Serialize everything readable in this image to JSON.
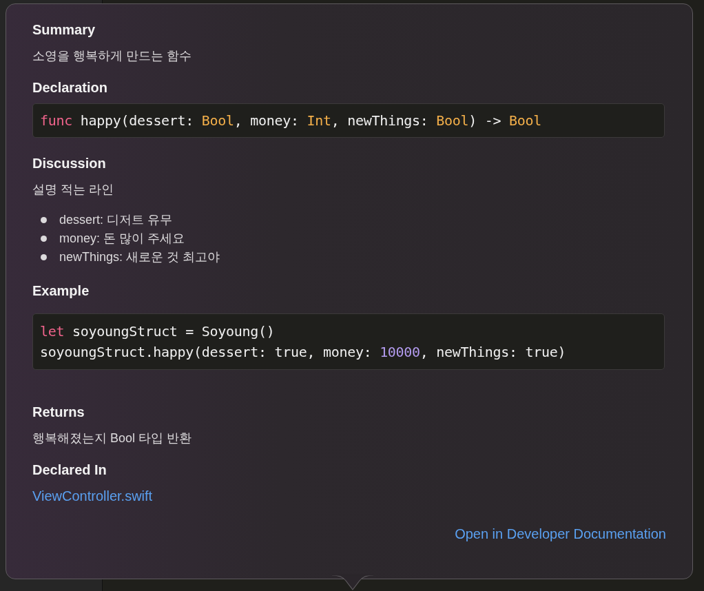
{
  "summary": {
    "heading": "Summary",
    "text": "소영을 행복하게 만드는 함수"
  },
  "declaration": {
    "heading": "Declaration",
    "lines": [
      [
        {
          "kind": "keyword",
          "text": "func"
        },
        {
          "kind": "plain",
          "text": " happy(dessert: "
        },
        {
          "kind": "type",
          "text": "Bool"
        },
        {
          "kind": "plain",
          "text": ", money: "
        },
        {
          "kind": "type",
          "text": "Int"
        },
        {
          "kind": "plain",
          "text": ", newThings: "
        },
        {
          "kind": "type",
          "text": "Bool"
        },
        {
          "kind": "plain",
          "text": ") -> "
        },
        {
          "kind": "type",
          "text": "Bool"
        }
      ]
    ]
  },
  "discussion": {
    "heading": "Discussion",
    "text": "설명 적는 라인",
    "bullets": [
      "dessert: 디저트 유무",
      "money: 돈 많이 주세요",
      "newThings: 새로운 것 최고야"
    ]
  },
  "example": {
    "heading": "Example",
    "lines": [
      [
        {
          "kind": "keyword",
          "text": "let"
        },
        {
          "kind": "plain",
          "text": " soyoungStruct = Soyoung()"
        }
      ],
      [
        {
          "kind": "plain",
          "text": "soyoungStruct.happy(dessert: true, money: "
        },
        {
          "kind": "number",
          "text": "10000"
        },
        {
          "kind": "plain",
          "text": ", newThings: true)"
        }
      ]
    ]
  },
  "returns": {
    "heading": "Returns",
    "text": "행복해졌는지 Bool 타입 반환"
  },
  "declared_in": {
    "heading": "Declared In",
    "link": "ViewController.swift"
  },
  "footer_link": "Open in Developer Documentation"
}
